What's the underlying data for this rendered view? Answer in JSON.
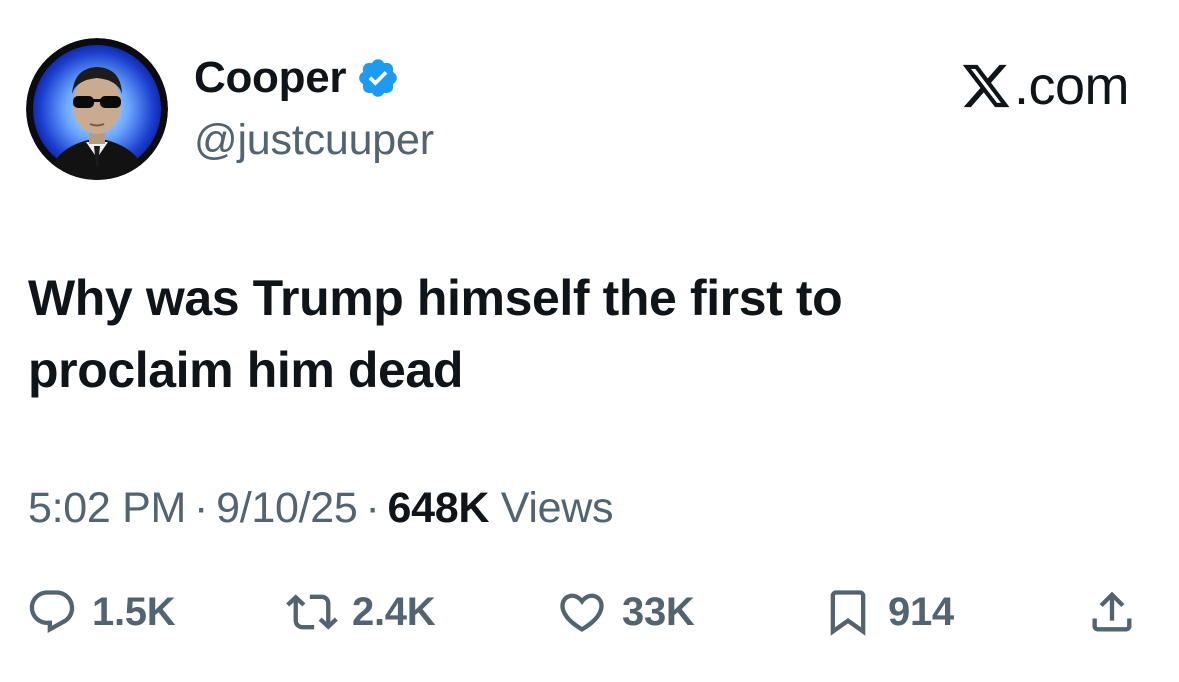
{
  "author": {
    "name": "Cooper",
    "handle": "@justcuuper"
  },
  "brand": {
    "logo_icon": "x-logo-icon",
    "text": ".com"
  },
  "tweet": {
    "text_line1": "Why was Trump himself the first to",
    "text_line2": "proclaim him dead"
  },
  "meta": {
    "time": "5:02 PM",
    "separator": "·",
    "date": "9/10/25",
    "views_count": "648K",
    "views_label": "Views"
  },
  "actions": {
    "replies": "1.5K",
    "reposts": "2.4K",
    "likes": "33K",
    "bookmarks": "914"
  },
  "colors": {
    "text": "#0f1419",
    "secondary": "#536471",
    "verified": "#1d9bf0",
    "background": "#ffffff"
  }
}
